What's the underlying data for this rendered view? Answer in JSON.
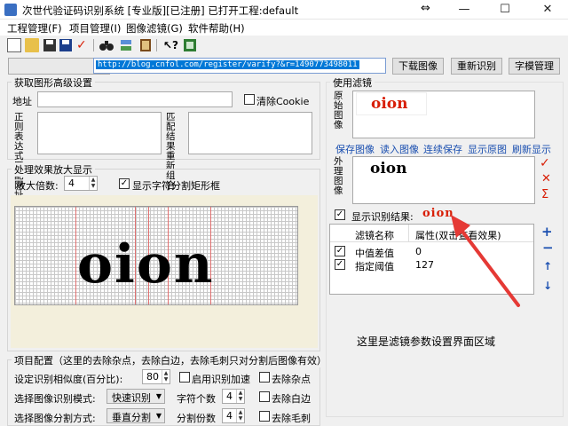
{
  "window": {
    "title": "次世代验证码识别系统 [专业版][已注册] 已打开工程:default",
    "resize_glyph": "⇔",
    "minimize": "—",
    "maximize": "☐",
    "close": "✕"
  },
  "menu": [
    "工程管理(F)",
    "项目管理(I)",
    "图像滤镜(G)",
    "软件帮助(H)"
  ],
  "toolbar_icons": [
    "new-icon",
    "open-icon",
    "save-icon",
    "save-as-icon",
    "check-icon",
    "binoculars-icon",
    "stack-icon",
    "book-icon",
    "help-pointer-icon",
    "exit-icon"
  ],
  "url": {
    "value": "http://blog.cnfol.com/register/varify?&r=1490773498011"
  },
  "buttons": {
    "download": "下载图像",
    "recognize": "重新识别",
    "font_mgr": "字模管理"
  },
  "advanced": {
    "title": "获取图形高级设置",
    "address_label": "地址",
    "clear_cookie": "清除Cookie",
    "regex_label": "正则表达式匹配网址",
    "match_label": "匹配结果重新组合"
  },
  "zoom": {
    "title": "处理效果放大显示",
    "factor_label": "放大倍数:",
    "factor_value": "4",
    "show_rect": "显示字符分割矩形框"
  },
  "preview_text": "oion",
  "project": {
    "title": "项目配置（这里的去除杂点，去除白边，去除毛刺只对分割后图像有效）",
    "similarity_label": "设定识别相似度(百分比):",
    "similarity_value": "80",
    "accelerate": "启用识别加速",
    "remove_noise": "去除杂点",
    "mode_label": "选择图像识别模式:",
    "mode_value": "快速识别",
    "char_count_label": "字符个数",
    "char_count_value": "4",
    "remove_border": "去除白边",
    "split_label": "选择图像分割方式:",
    "split_value": "垂直分割",
    "split_parts_label": "分割份数",
    "split_parts_value": "4",
    "remove_burr": "去除毛刺"
  },
  "filter": {
    "title": "使用滤镜",
    "original_label": "原始图像",
    "original_text": "oion",
    "links": [
      "保存图像",
      "读入图像",
      "连续保存",
      "显示原图",
      "刷新显示"
    ],
    "external_label": "外理图像",
    "processed_text": "oion",
    "show_result_label": "显示识别结果:",
    "result_text": "oion",
    "side_icons": [
      "✓",
      "✕",
      "Σ"
    ],
    "list_headers": [
      "滤镜名称",
      "属性(双击查看效果)"
    ],
    "list_rows": [
      {
        "name": "中值差值",
        "value": "0",
        "checked": true
      },
      {
        "name": "指定阈值",
        "value": "127",
        "checked": true
      }
    ],
    "list_buttons": [
      "+",
      "−",
      "↑",
      "↓"
    ],
    "note": "这里是滤镜参数设置界面区域"
  },
  "colors": {
    "accent": "#0078d7",
    "red": "#d81e06",
    "link": "#1a4fb0"
  }
}
